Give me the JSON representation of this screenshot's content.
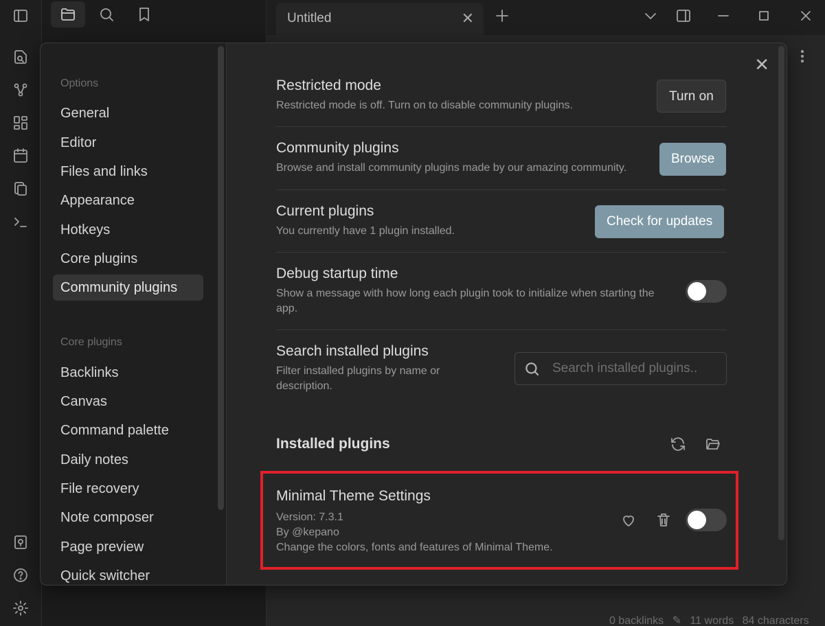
{
  "tab": {
    "title": "Untitled"
  },
  "status": {
    "backlinks": "0 backlinks",
    "words": "11 words",
    "characters": "84 characters"
  },
  "sidebar": {
    "options_header": "Options",
    "options": [
      "General",
      "Editor",
      "Files and links",
      "Appearance",
      "Hotkeys",
      "Core plugins",
      "Community plugins"
    ],
    "active": "Community plugins",
    "core_header": "Core plugins",
    "core": [
      "Backlinks",
      "Canvas",
      "Command palette",
      "Daily notes",
      "File recovery",
      "Note composer",
      "Page preview",
      "Quick switcher"
    ]
  },
  "settings": {
    "restricted": {
      "name": "Restricted mode",
      "desc": "Restricted mode is off. Turn on to disable community plugins.",
      "button": "Turn on"
    },
    "community": {
      "name": "Community plugins",
      "desc": "Browse and install community plugins made by our amazing community.",
      "button": "Browse"
    },
    "current": {
      "name": "Current plugins",
      "desc": "You currently have 1 plugin installed.",
      "button": "Check for updates"
    },
    "debug": {
      "name": "Debug startup time",
      "desc_line1": "Show a message with how long each plugin took to initialize when starting the",
      "desc_line2": "app.",
      "enabled": false
    },
    "search": {
      "name": "Search installed plugins",
      "desc_line1": "Filter installed plugins by name or",
      "desc_line2": "description.",
      "placeholder": "Search installed plugins.."
    }
  },
  "installed": {
    "heading": "Installed plugins",
    "plugins": [
      {
        "name": "Minimal Theme Settings",
        "version": "Version: 7.3.1",
        "author": "By @kepano",
        "description": "Change the colors, fonts and features of Minimal Theme.",
        "enabled": false
      }
    ]
  },
  "colors": {
    "accent_button": "#7e98a5",
    "highlight": "#e0202a"
  }
}
